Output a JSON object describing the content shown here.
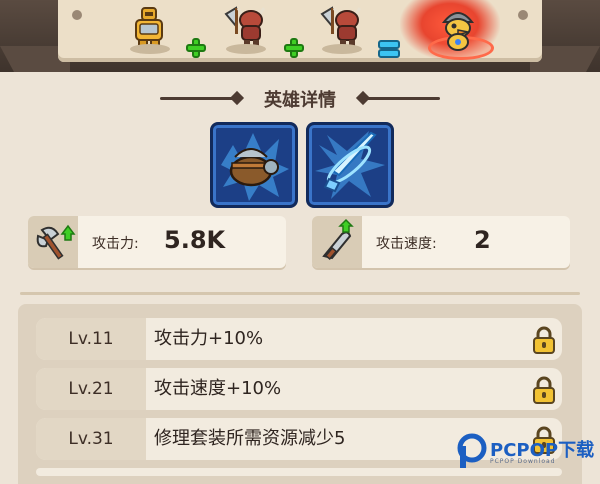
{
  "section": {
    "title": "英雄详情"
  },
  "craft_bar": {
    "slots": [
      {
        "icon": "golden-armor-hero-icon"
      },
      {
        "icon": "axe-viking-hero-icon"
      },
      {
        "icon": "axe-viking-hero-icon"
      },
      {
        "icon": "duck-helmet-hero-icon"
      }
    ],
    "operators": [
      "plus-icon",
      "plus-icon",
      "equals-icon"
    ],
    "colors": {
      "plus": "#3fcf25",
      "equals": "#3cc4f2",
      "highlight": "#e8452f"
    }
  },
  "skills": [
    {
      "icon": "armored-pot-skill-icon"
    },
    {
      "icon": "blue-sword-skill-icon"
    }
  ],
  "stats": {
    "attack": {
      "icon": "axe-upgrade-icon",
      "label": "攻击力:",
      "value": "5.8K"
    },
    "speed": {
      "icon": "feather-upgrade-icon",
      "label": "攻击速度:",
      "value": "2"
    }
  },
  "levels": [
    {
      "lv": "Lv.11",
      "text": "攻击力+10%",
      "locked": true
    },
    {
      "lv": "Lv.21",
      "text": "攻击速度+10%",
      "locked": true
    },
    {
      "lv": "Lv.31",
      "text": "修理套装所需资源减少5",
      "locked": true
    }
  ],
  "watermark": {
    "brand": "PCPOP下载",
    "sub": "PCPOP Download"
  }
}
